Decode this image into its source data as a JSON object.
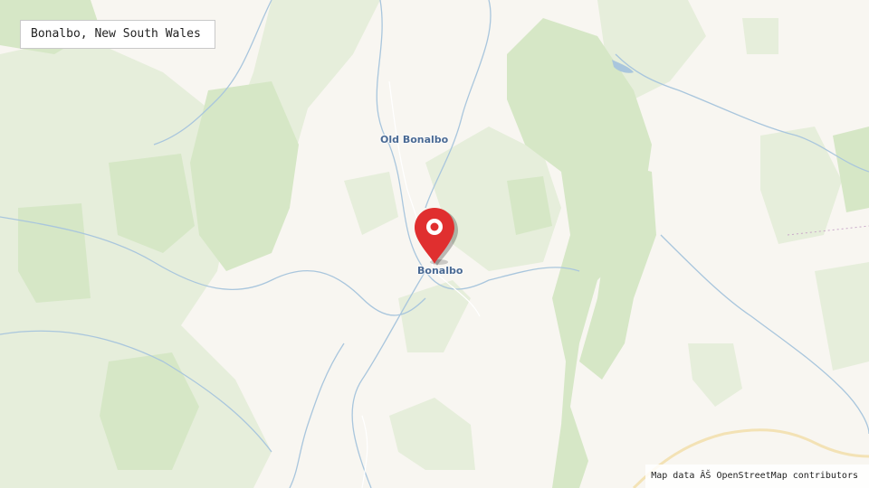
{
  "map": {
    "title": "Bonalbo, New South Wales",
    "places": {
      "old_bonalbo": "Old Bonalbo",
      "bonalbo": "Bonalbo"
    },
    "attribution": "Map data ÂŠ OpenStreetMap contributors",
    "marker_icon": "map-pin-icon",
    "colors": {
      "land": "#f8f6f1",
      "forest_light": "#e6eedb",
      "forest": "#d6e7c6",
      "water": "#a9c6dd",
      "road": "#f3e2b5",
      "marker": "#e02f2f",
      "label": "#4a6a94"
    }
  }
}
